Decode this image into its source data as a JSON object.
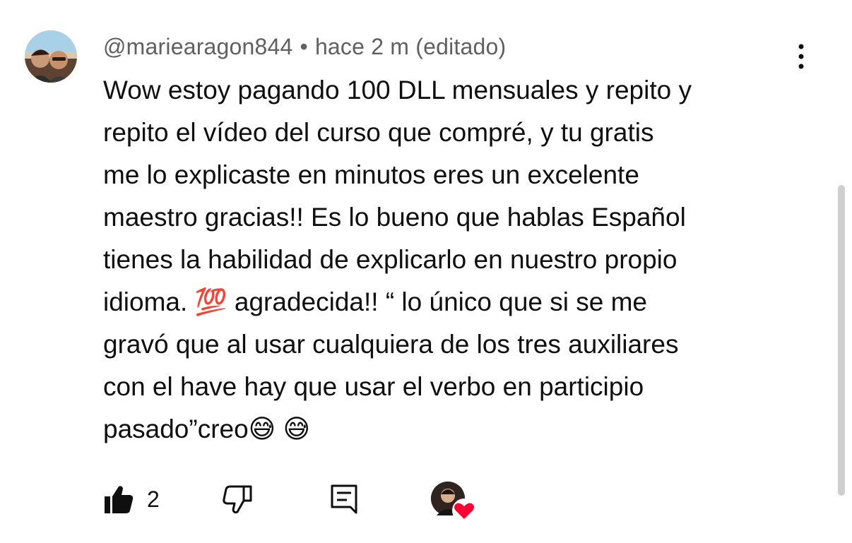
{
  "comment": {
    "author": "@mariearagon844",
    "separator": "•",
    "time": "hace 2 m (editado)",
    "text": "Wow estoy pagando 100 DLL mensuales y repito y\nrepito el vídeo del curso que compré, y tu gratis\nme lo explicaste en minutos eres un excelente\nmaestro gracias!! Es lo bueno que hablas Español\ntienes la habilidad de explicarlo en nuestro propio\nidioma. 💯 agradecida!! “ lo único que si se me\ngravó que al usar cualquiera de los tres auxiliares\ncon el have hay que usar el verbo en participio\npasado”creo😅 😅",
    "likes": "2"
  },
  "icons": {
    "more": "more-vertical-icon",
    "like": "thumbs-up-icon",
    "dislike": "thumbs-down-icon",
    "reply": "reply-comment-icon",
    "heart": "heart-icon"
  },
  "colors": {
    "text": "#0f0f0f",
    "meta": "#606060",
    "heart": "#ff0033",
    "scrollbar": "#cfcfcf"
  }
}
